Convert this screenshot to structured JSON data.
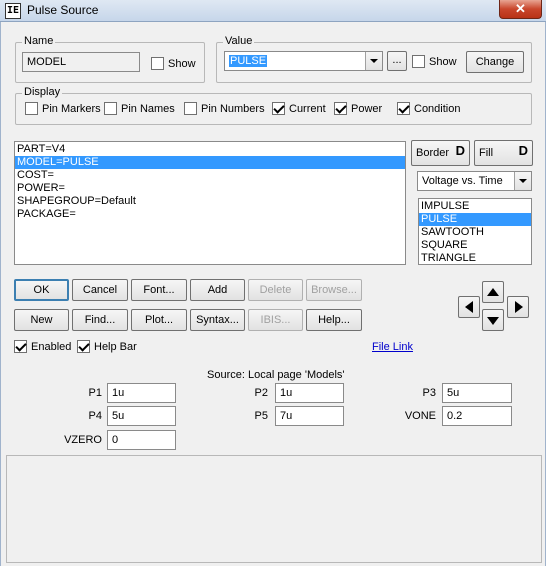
{
  "window": {
    "title": "Pulse Source",
    "icon_text": "IE",
    "close_label": "✕"
  },
  "name_group": {
    "label": "Name",
    "value": "MODEL",
    "show_label": "Show",
    "show_checked": false
  },
  "value_group": {
    "label": "Value",
    "value": "PULSE",
    "browse_label": "...",
    "show_label": "Show",
    "show_checked": false,
    "change_label": "Change"
  },
  "display_group": {
    "label": "Display",
    "options": [
      {
        "label": "Pin Markers",
        "checked": false
      },
      {
        "label": "Pin Names",
        "checked": false
      },
      {
        "label": "Pin Numbers",
        "checked": false
      },
      {
        "label": "Current",
        "checked": true
      },
      {
        "label": "Power",
        "checked": true
      },
      {
        "label": "Condition",
        "checked": true
      }
    ]
  },
  "attributes": {
    "items": [
      "PART=V4",
      "MODEL=PULSE",
      "COST=",
      "POWER=",
      "SHAPEGROUP=Default",
      "PACKAGE="
    ],
    "selected_index": 1
  },
  "style_buttons": {
    "border_label": "Border",
    "fill_label": "Fill",
    "icon_glyph": "D"
  },
  "plot_select": {
    "value": "Voltage vs. Time"
  },
  "model_types": {
    "items": [
      "IMPULSE",
      "PULSE",
      "SAWTOOTH",
      "SQUARE",
      "TRIANGLE"
    ],
    "selected_index": 1
  },
  "buttons": {
    "ok": "OK",
    "cancel": "Cancel",
    "font": "Font...",
    "add": "Add",
    "delete": "Delete",
    "browse": "Browse...",
    "new": "New",
    "find": "Find...",
    "plot": "Plot...",
    "syntax": "Syntax...",
    "ibis": "IBIS...",
    "help": "Help..."
  },
  "options": {
    "enabled_label": "Enabled",
    "enabled_checked": true,
    "helpbar_label": "Help Bar",
    "helpbar_checked": true,
    "file_link": "File Link"
  },
  "params": {
    "source_text": "Source: Local page 'Models'",
    "fields": [
      {
        "name": "P1",
        "value": "1u"
      },
      {
        "name": "P2",
        "value": "1u"
      },
      {
        "name": "P3",
        "value": "5u"
      },
      {
        "name": "P4",
        "value": "5u"
      },
      {
        "name": "P5",
        "value": "7u"
      },
      {
        "name": "VONE",
        "value": "0.2"
      },
      {
        "name": "VZERO",
        "value": "0"
      }
    ]
  },
  "colors": {
    "selection": "#3399ff",
    "link": "#0000cc",
    "default_button_border": "#3c7fb1"
  }
}
